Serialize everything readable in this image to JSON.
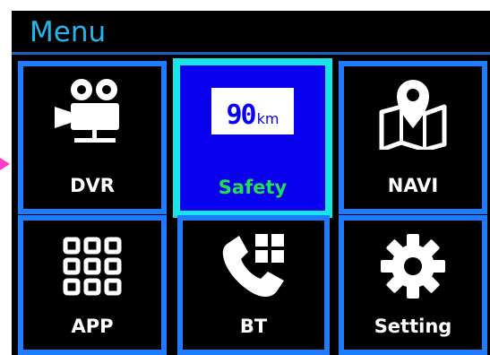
{
  "header": {
    "title": "Menu"
  },
  "tiles": [
    {
      "label": "DVR",
      "icon": "video-camera-icon"
    },
    {
      "label": "Safety",
      "icon": "speed-display-icon",
      "selected": true,
      "speed_value": "90",
      "speed_unit": "km"
    },
    {
      "label": "NAVI",
      "icon": "map-pin-icon"
    },
    {
      "label": "APP",
      "icon": "app-grid-icon"
    },
    {
      "label": "BT",
      "icon": "phone-keypad-icon"
    },
    {
      "label": "Setting",
      "icon": "gear-icon"
    }
  ],
  "colors": {
    "title": "#24b5f0",
    "tile_border": "#1f7bff",
    "selected_border": "#18e6e6",
    "selected_bg": "#0a00f0",
    "selected_label": "#1fe14f",
    "pointer": "#ff3cc8"
  }
}
